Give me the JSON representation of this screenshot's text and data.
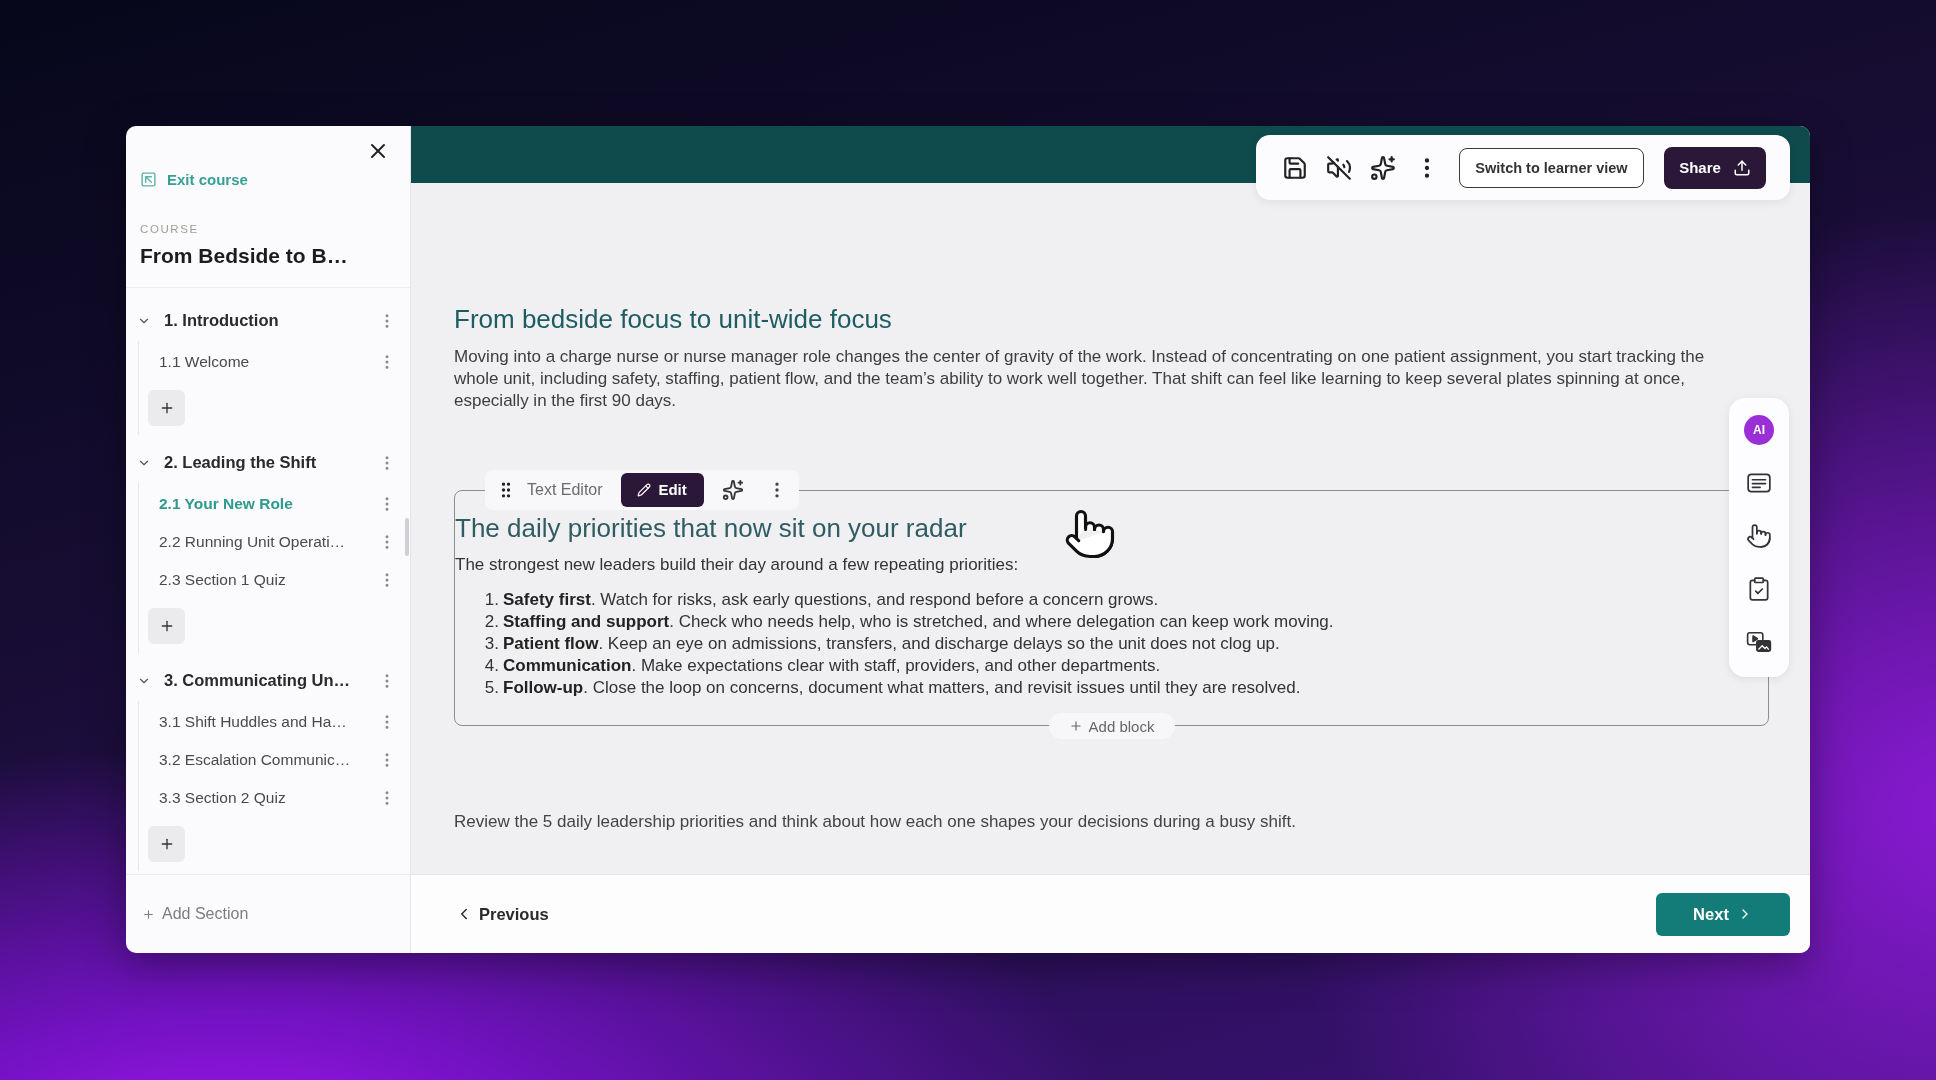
{
  "sidebar": {
    "exit_link": "Exit course",
    "course_label": "COURSE",
    "course_title": "From Bedside to B…",
    "sections": [
      {
        "title": "1. Introduction",
        "expanded": true,
        "lessons": [
          {
            "title": "1.1 Welcome",
            "selected": false
          }
        ]
      },
      {
        "title": "2. Leading the Shift",
        "expanded": true,
        "lessons": [
          {
            "title": "2.1 Your New Role",
            "selected": true
          },
          {
            "title": "2.2 Running Unit Operati…",
            "selected": false
          },
          {
            "title": "2.3 Section 1 Quiz",
            "selected": false
          }
        ]
      },
      {
        "title": "3. Communicating Un…",
        "expanded": true,
        "lessons": [
          {
            "title": "3.1 Shift Huddles and Ha…",
            "selected": false
          },
          {
            "title": "3.2 Escalation Communic…",
            "selected": false
          },
          {
            "title": "3.3 Section 2 Quiz",
            "selected": false
          }
        ]
      }
    ],
    "add_section": "Add Section"
  },
  "toolbar": {
    "learner_view_button": "Switch to learner view",
    "share_button": "Share"
  },
  "content": {
    "heading": "From bedside focus to unit-wide focus",
    "paragraph": "Moving into a charge nurse or nurse manager role changes the center of gravity of the work. Instead of concentrating on one patient assignment, you start tracking the whole unit, including safety, staffing, patient flow, and the team’s ability to work well together. That shift can feel like learning to keep several plates spinning at once, especially in the first 90 days.",
    "text_block": {
      "label": "Text Editor",
      "edit_button": "Edit",
      "heading": "The daily priorities that now sit on your radar",
      "intro": "The strongest new leaders build their day around a few repeating priorities:",
      "priorities": [
        {
          "number": "1.",
          "text": "**Safety first**. Watch for risks, ask early questions, and respond before a concern grows."
        },
        {
          "number": "2.",
          "text": "**Staffing and support**. Check who needs help, who is stretched, and where delegation can keep work moving."
        },
        {
          "number": "3.",
          "text": "**Patient flow**. Keep an eye on admissions, transfers, and discharge delays so the unit does not clog up."
        },
        {
          "number": "4.",
          "text": "**Communication**. Make expectations clear with staff, providers, and other departments."
        },
        {
          "number": "5.",
          "text": "**Follow-up**. Close the loop on concerns, document what matters, and revisit issues until they are resolved."
        }
      ],
      "add_block_button": "Add block"
    },
    "footer_text": "Review the 5 daily leadership priorities and think about how each one shapes your decisions during a busy shift."
  },
  "side_rail": {
    "ai_badge": "AI"
  },
  "navigation": {
    "previous_button": "Previous",
    "next_button": "Next"
  }
}
